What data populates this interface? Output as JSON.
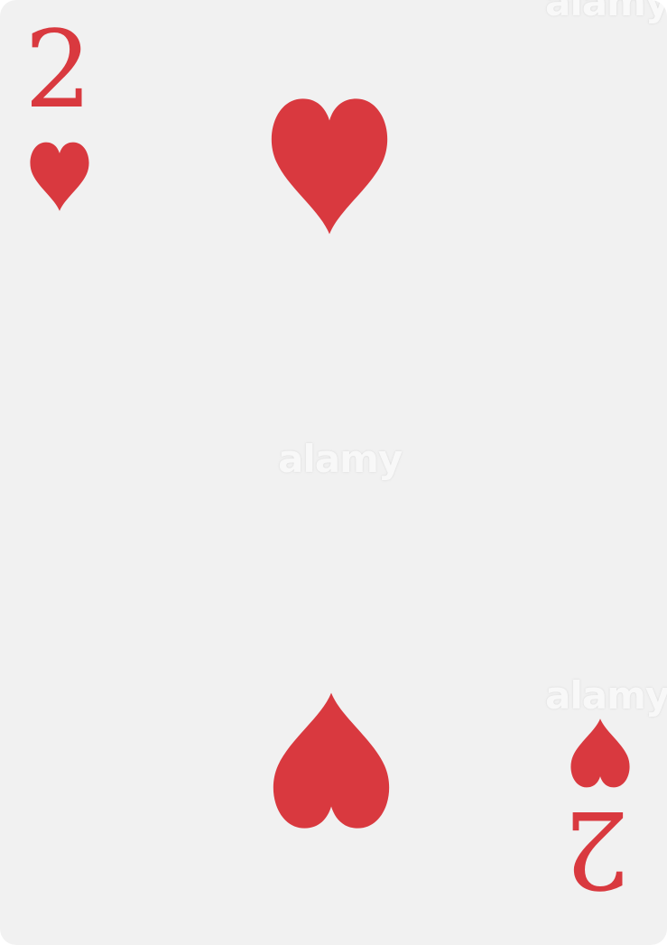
{
  "card": {
    "rank": "2",
    "suit_icon": "heart-icon",
    "suit_color": "#d9393f",
    "background": "#f1f1f1"
  },
  "watermark": {
    "text": "alamy"
  }
}
